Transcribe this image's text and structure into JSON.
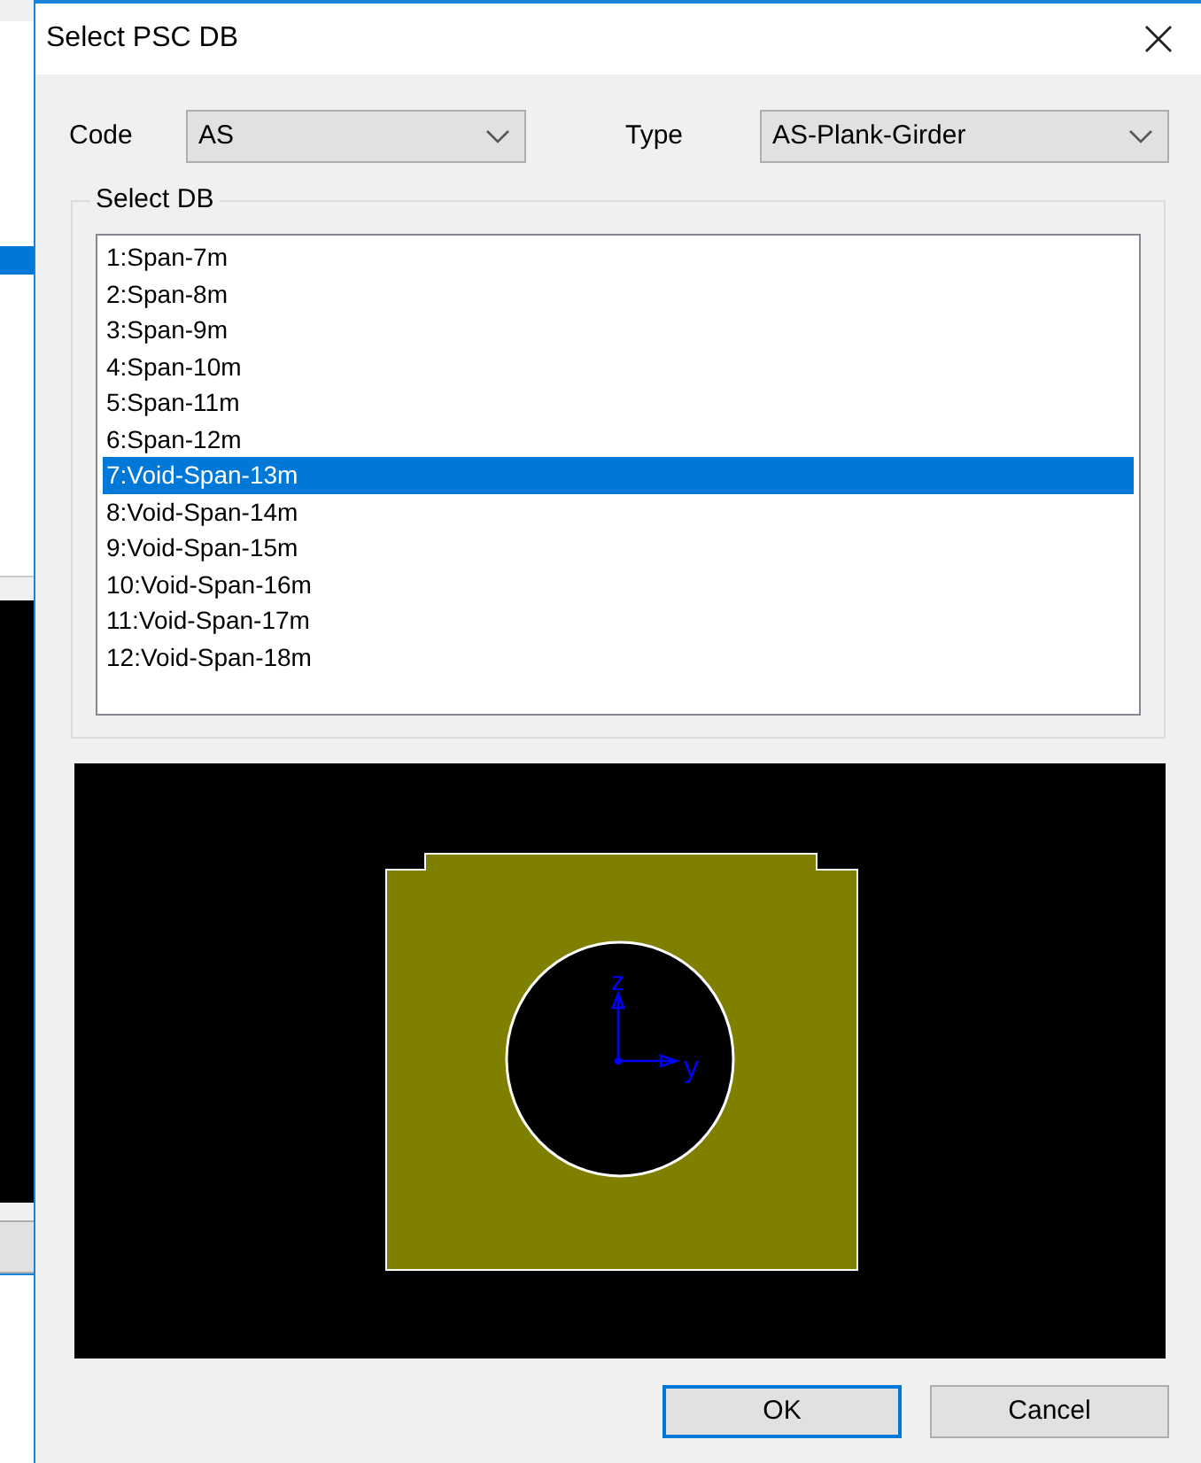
{
  "window": {
    "title": "Select PSC DB"
  },
  "code": {
    "label": "Code",
    "value": "AS"
  },
  "type": {
    "label": "Type",
    "value": "AS-Plank-Girder"
  },
  "select_db": {
    "title": "Select DB",
    "items": [
      {
        "label": "1:Span-7m",
        "selected": false
      },
      {
        "label": "2:Span-8m",
        "selected": false
      },
      {
        "label": "3:Span-9m",
        "selected": false
      },
      {
        "label": "4:Span-10m",
        "selected": false
      },
      {
        "label": "5:Span-11m",
        "selected": false
      },
      {
        "label": "6:Span-12m",
        "selected": false
      },
      {
        "label": "7:Void-Span-13m",
        "selected": true
      },
      {
        "label": "8:Void-Span-14m",
        "selected": false
      },
      {
        "label": "9:Void-Span-15m",
        "selected": false
      },
      {
        "label": "10:Void-Span-16m",
        "selected": false
      },
      {
        "label": "11:Void-Span-17m",
        "selected": false
      },
      {
        "label": "12:Void-Span-18m",
        "selected": false
      }
    ]
  },
  "preview": {
    "axis_z": "z",
    "axis_y": "y"
  },
  "buttons": [
    {
      "label": "OK",
      "default": true
    },
    {
      "label": "Cancel",
      "default": false
    }
  ]
}
